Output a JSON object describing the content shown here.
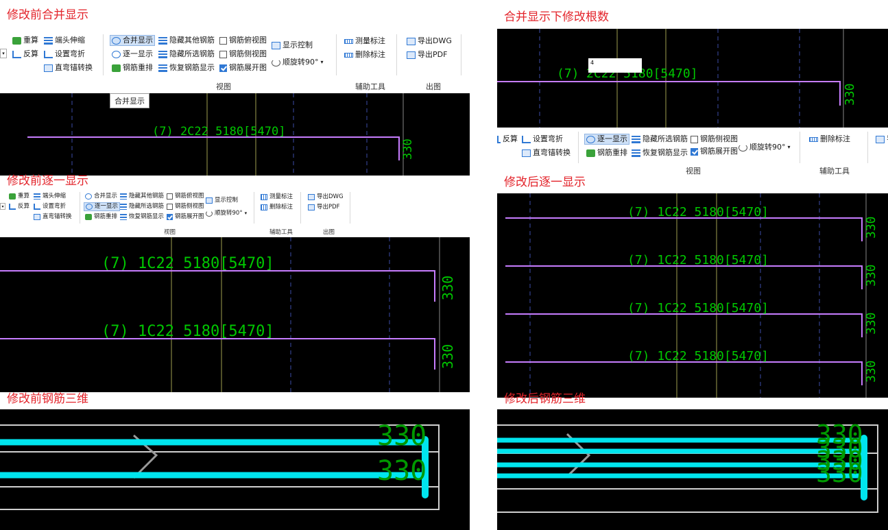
{
  "headings": {
    "merge_before": "修改前合并显示",
    "merge_modify": "合并显示下修改根数",
    "each_before": "修改前逐一显示",
    "each_after": "修改后逐一显示",
    "rebar3d_before": "修改前钢筋三维",
    "rebar3d_after": "修改后钢筋三维"
  },
  "ribbon": {
    "recalc": "重算",
    "flip": "反算",
    "end_extend": "端头伸缩",
    "set_bend": "设置弯折",
    "straight_bent_convert": "直弯锚转换",
    "merge_display": "合并显示",
    "each_display": "逐一显示",
    "rebar_reorder": "钢筋重排",
    "hide_other_rebar": "隐藏其他钢筋",
    "hide_selected_rebar": "隐藏所选钢筋",
    "restore_rebar_display": "恢复钢筋显示",
    "rebar_top_view": "钢筋俯视图",
    "rebar_side_view": "钢筋侧视图",
    "rebar_unfold_view": "钢筋展开图",
    "display_control": "显示控制",
    "rotate_90": "顺旋转90°",
    "measure_annotation": "测量标注",
    "delete_annotation": "删除标注",
    "export_dwg": "导出DWG",
    "export_pdf": "导出PDF",
    "export_partial": "导",
    "group_view": "视图",
    "group_aux_tools": "辅助工具",
    "group_output": "出图"
  },
  "tooltip": "合并显示",
  "count_input_value": "4",
  "rebar_labels": {
    "merged": "(7) 2C22 5180[5470]",
    "merged_edit_tail": "2C22 5180[5470]",
    "merged_edit_head": "(7)",
    "single": "(7) 1C22 5180[5470]",
    "hook": "330",
    "hook_3d": "330"
  },
  "colors": {
    "heading": "#e3242b",
    "canvas": "#000000",
    "rebar_line": "#c77dff",
    "annotation": "#00c800",
    "rebar_3d": "#00e5ee",
    "grid_blue": "#3c4ba8",
    "grid_yellow": "#a0a050",
    "grid_white": "#888888"
  }
}
